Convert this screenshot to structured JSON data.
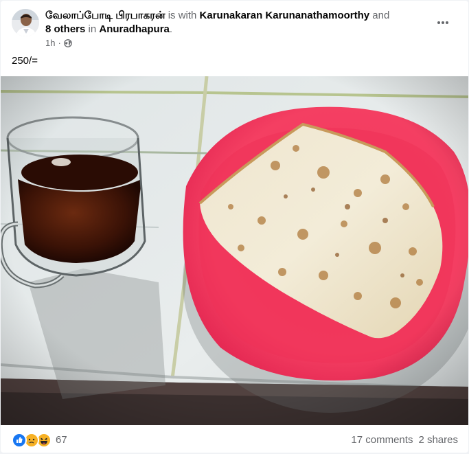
{
  "post": {
    "author": "வேலாப்போடி பிரபாகரன்",
    "with_text": " is with ",
    "tagged_person": "Karunakaran Karunanathamoorthy",
    "and_text": " and",
    "others": "8 others",
    "in_text": " in ",
    "location": "Anuradhapura",
    "period": ".",
    "time": "1h",
    "dot": "·",
    "privacy_icon": "globe-icon",
    "menu_icon": "more-horizontal-icon",
    "caption": "250/="
  },
  "photo": {
    "subject": "tea-glass-and-paratha-on-red-plate"
  },
  "footer": {
    "reaction_icons": [
      "like-icon",
      "sad-icon",
      "haha-icon"
    ],
    "reaction_count": "67",
    "comments": "17 comments",
    "shares": "2 shares"
  },
  "colors": {
    "like": "#1877f2",
    "reaction_yellow": "#f7b125",
    "muted_text": "#65676b",
    "plate": "#f2385e"
  }
}
